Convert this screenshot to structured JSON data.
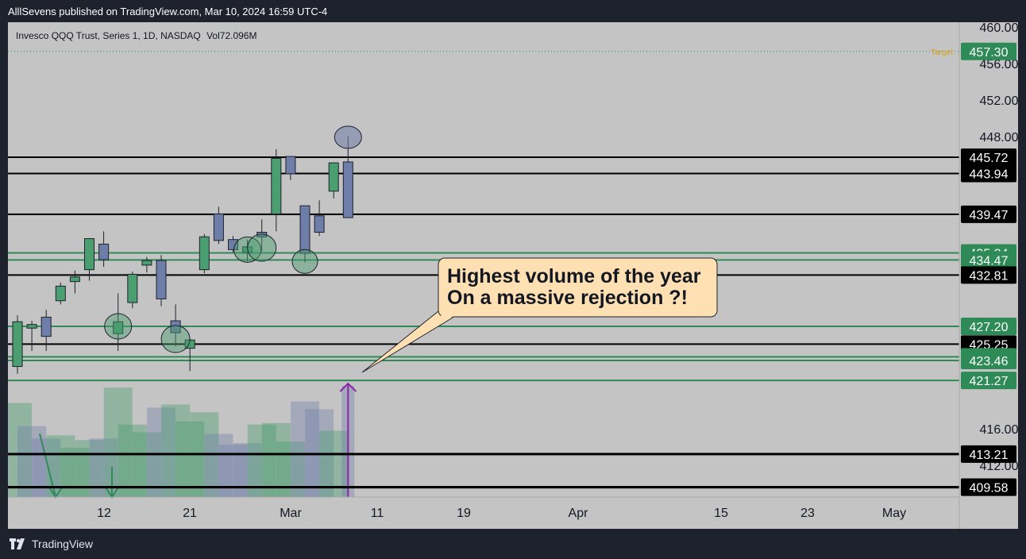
{
  "header": {
    "published": "AlllSevens published on TradingView.com, Mar 10, 2024 16:59 UTC-4"
  },
  "legend": {
    "symbol": "Invesco QQQ Trust, Series 1, 1D, NASDAQ",
    "volume": "Vol72.096M"
  },
  "footer": {
    "brand": "TradingView"
  },
  "colors": {
    "up": "#4a9e6f",
    "down": "#6f7ea8",
    "support": "#2e8b57",
    "resistance": "#000000",
    "callout_bg": "#ffe0b2",
    "arrow": "#8e24aa",
    "target": "#d4a017"
  },
  "annotation": {
    "line1": "Highest volume of the year",
    "line2": "On a massive rejection ?!"
  },
  "chart_data": {
    "type": "candlestick",
    "symbol": "QQQ",
    "interval": "1D",
    "exchange": "NASDAQ",
    "y_axis_ticks": [
      "460.00",
      "456.00",
      "452.00",
      "448.00",
      "416.00",
      "412.00"
    ],
    "x_axis_ticks": [
      "12",
      "21",
      "Mar",
      "11",
      "19",
      "Apr",
      "15",
      "23",
      "May"
    ],
    "ylim": [
      408.5,
      460.5
    ],
    "levels": [
      {
        "value": 457.3,
        "label": "457.30",
        "kind": "target",
        "tag": "Target"
      },
      {
        "value": 445.72,
        "label": "445.72",
        "kind": "resistance"
      },
      {
        "value": 443.94,
        "label": "443.94",
        "kind": "resistance"
      },
      {
        "value": 439.47,
        "label": "439.47",
        "kind": "resistance"
      },
      {
        "value": 435.24,
        "label": "435.24",
        "kind": "support"
      },
      {
        "value": 434.47,
        "label": "434.47",
        "kind": "support"
      },
      {
        "value": 432.81,
        "label": "432.81",
        "kind": "resistance"
      },
      {
        "value": 427.2,
        "label": "427.20",
        "kind": "support"
      },
      {
        "value": 425.25,
        "label": "425.25",
        "kind": "resistance"
      },
      {
        "value": 423.86,
        "label": "423.86",
        "kind": "support"
      },
      {
        "value": 423.46,
        "label": "423.46",
        "kind": "support"
      },
      {
        "value": 421.27,
        "label": "421.27",
        "kind": "support"
      },
      {
        "value": 413.21,
        "label": "413.21",
        "kind": "resistance"
      },
      {
        "value": 409.59,
        "label": "409.59",
        "kind": "resistance"
      },
      {
        "value": 409.58,
        "label": "409.58",
        "kind": "resistance"
      }
    ],
    "candles": [
      {
        "date": "Feb 5",
        "open": 422.8,
        "high": 428.4,
        "low": 422.0,
        "close": 427.7
      },
      {
        "date": "Feb 6",
        "open": 427.0,
        "high": 427.8,
        "low": 424.5,
        "close": 427.4
      },
      {
        "date": "Feb 7",
        "open": 428.2,
        "high": 429.0,
        "low": 424.5,
        "close": 426.1
      },
      {
        "date": "Feb 8",
        "open": 430.0,
        "high": 432.0,
        "low": 429.6,
        "close": 431.6
      },
      {
        "date": "Feb 9",
        "open": 432.1,
        "high": 433.3,
        "low": 430.8,
        "close": 432.6
      },
      {
        "date": "Feb 12",
        "open": 433.4,
        "high": 436.2,
        "low": 432.2,
        "close": 436.8
      },
      {
        "date": "Feb 13",
        "open": 436.2,
        "high": 437.6,
        "low": 433.7,
        "close": 434.5
      },
      {
        "date": "Feb 14",
        "open": 426.4,
        "high": 430.8,
        "low": 424.5,
        "close": 427.7
      },
      {
        "date": "Feb 15",
        "open": 429.8,
        "high": 433.2,
        "low": 429.2,
        "close": 432.9
      },
      {
        "date": "Feb 16",
        "open": 433.9,
        "high": 434.8,
        "low": 433.1,
        "close": 434.4
      },
      {
        "date": "Feb 20",
        "open": 434.4,
        "high": 435.0,
        "low": 429.4,
        "close": 430.2
      },
      {
        "date": "Feb 21",
        "open": 427.8,
        "high": 429.6,
        "low": 425.0,
        "close": 426.5
      },
      {
        "date": "Feb 22",
        "open": 424.8,
        "high": 425.8,
        "low": 422.3,
        "close": 425.7
      },
      {
        "date": "Feb 23",
        "open": 433.4,
        "high": 437.3,
        "low": 433.0,
        "close": 437.0
      },
      {
        "date": "Feb 26",
        "open": 439.5,
        "high": 440.3,
        "low": 436.2,
        "close": 436.6
      },
      {
        "date": "Feb 27",
        "open": 436.7,
        "high": 437.1,
        "low": 435.3,
        "close": 435.6
      },
      {
        "date": "Feb 28",
        "open": 435.3,
        "high": 436.7,
        "low": 434.3,
        "close": 435.9
      },
      {
        "date": "Feb 29",
        "open": 437.5,
        "high": 438.9,
        "low": 435.4,
        "close": 437.0
      },
      {
        "date": "Mar 1",
        "open": 439.5,
        "high": 446.6,
        "low": 437.6,
        "close": 445.6
      },
      {
        "date": "Mar 4",
        "open": 445.8,
        "high": 445.6,
        "low": 443.2,
        "close": 443.9
      },
      {
        "date": "Mar 5",
        "open": 440.4,
        "high": 440.4,
        "low": 434.2,
        "close": 435.2
      },
      {
        "date": "Mar 6",
        "open": 439.3,
        "high": 441.0,
        "low": 437.1,
        "close": 437.5
      },
      {
        "date": "Mar 7",
        "open": 442.0,
        "high": 444.9,
        "low": 441.2,
        "close": 445.1
      },
      {
        "date": "Mar 8",
        "open": 445.2,
        "high": 448.0,
        "low": 439.1,
        "close": 439.1
      }
    ],
    "volume": [
      {
        "date": "Feb 5",
        "value": 61,
        "dir": "up"
      },
      {
        "date": "Feb 6",
        "value": 46,
        "dir": "down"
      },
      {
        "date": "Feb 7",
        "value": 38,
        "dir": "down"
      },
      {
        "date": "Feb 8",
        "value": 40,
        "dir": "up"
      },
      {
        "date": "Feb 9",
        "value": 32,
        "dir": "up"
      },
      {
        "date": "Feb 12",
        "value": 37,
        "dir": "up"
      },
      {
        "date": "Feb 13",
        "value": 38,
        "dir": "down"
      },
      {
        "date": "Feb 14",
        "value": 71,
        "dir": "up"
      },
      {
        "date": "Feb 15",
        "value": 47,
        "dir": "up"
      },
      {
        "date": "Feb 16",
        "value": 42,
        "dir": "up"
      },
      {
        "date": "Feb 20",
        "value": 58,
        "dir": "down"
      },
      {
        "date": "Feb 21",
        "value": 60,
        "dir": "up"
      },
      {
        "date": "Feb 22",
        "value": 49,
        "dir": "up"
      },
      {
        "date": "Feb 23",
        "value": 55,
        "dir": "up"
      },
      {
        "date": "Feb 26",
        "value": 41,
        "dir": "down"
      },
      {
        "date": "Feb 27",
        "value": 34,
        "dir": "down"
      },
      {
        "date": "Feb 28",
        "value": 35,
        "dir": "down"
      },
      {
        "date": "Feb 29",
        "value": 47,
        "dir": "up"
      },
      {
        "date": "Mar 1",
        "value": 48,
        "dir": "up"
      },
      {
        "date": "Mar 4",
        "value": 36,
        "dir": "up"
      },
      {
        "date": "Mar 5",
        "value": 62,
        "dir": "down"
      },
      {
        "date": "Mar 6",
        "value": 57,
        "dir": "down"
      },
      {
        "date": "Mar 7",
        "value": 43,
        "dir": "up"
      },
      {
        "date": "Mar 8",
        "value": 72.096,
        "dir": "down"
      }
    ]
  }
}
